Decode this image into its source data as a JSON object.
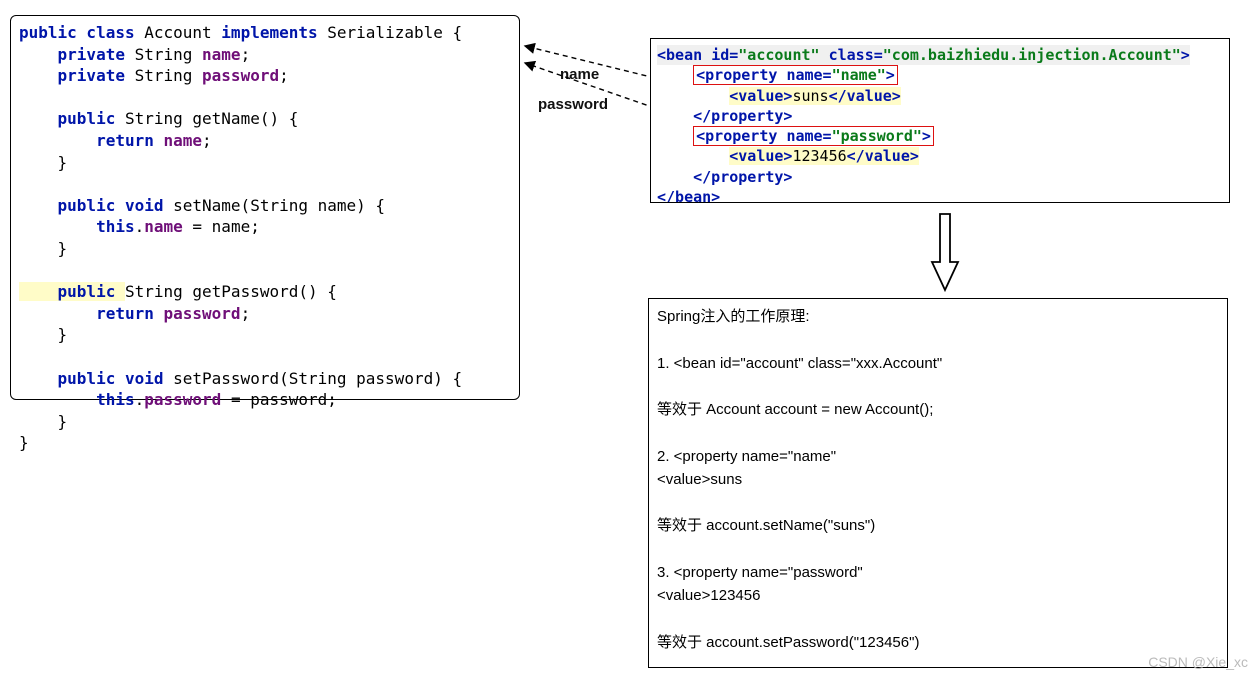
{
  "java": {
    "l1a": "public class ",
    "l1b": "Account ",
    "l1c": "implements ",
    "l1d": "Serializable {",
    "l2a": "    private ",
    "l2b": "String ",
    "l2c": "name",
    "l2d": ";",
    "l3a": "    private ",
    "l3b": "String ",
    "l3c": "password",
    "l3d": ";",
    "l4a": "    public ",
    "l4b": "String getName() {",
    "l5a": "        return ",
    "l5b": "name",
    "l5c": ";",
    "l6": "    }",
    "l7a": "    public void ",
    "l7b": "setName(String name) {",
    "l8a": "        this",
    "l8b": ".",
    "l8c": "name ",
    "l8d": "= name;",
    "l9": "    }",
    "l10a": "    public ",
    "l10b": "String getPassword() {",
    "l11a": "        return ",
    "l11b": "password",
    "l11c": ";",
    "l12": "    }",
    "l13a": "    public void ",
    "l13b": "setPassword(String password) {",
    "l14a": "        this",
    "l14b": ".",
    "l14c": "password ",
    "l14d": "= password;",
    "l15": "    }",
    "l16": "}"
  },
  "xml": {
    "bean_open_a": "<bean ",
    "bean_id_attr": "id=",
    "bean_id_val": "\"account\"",
    "bean_class_attr": " class=",
    "bean_class_val": "\"com.baizhiedu.injection.Account\"",
    "bean_open_b": ">",
    "prop1_a": "<property ",
    "prop1_name_attr": "name=",
    "prop1_name_val": "\"name\"",
    "prop1_b": ">",
    "val1_a": "<value>",
    "val1_b": "suns",
    "val1_c": "</value>",
    "prop1_close": "</property>",
    "prop2_a": "<property ",
    "prop2_name_attr": "name=",
    "prop2_name_val": "\"password\"",
    "prop2_b": ">",
    "val2_a": "<value>",
    "val2_b": "123456",
    "val2_c": "</value>",
    "prop2_close": "</property>",
    "bean_close": "</bean>"
  },
  "labels": {
    "name": "name",
    "password": "password"
  },
  "explain": {
    "title": "Spring注入的工作原理:",
    "l1": "1. <bean id=\"account\"  class=\"xxx.Account\"",
    "l2": "等效于  Account  account = new Account();",
    "l3": "2. <property name=\"name\"",
    "l3b": "        <value>suns",
    "l4": "等效于  account.setName(\"suns\")",
    "l5": "3. <property name=\"password\"",
    "l5b": "        <value>123456",
    "l6": "等效于  account.setPassword(\"123456\")"
  },
  "watermark": "CSDN @Xie_xc"
}
